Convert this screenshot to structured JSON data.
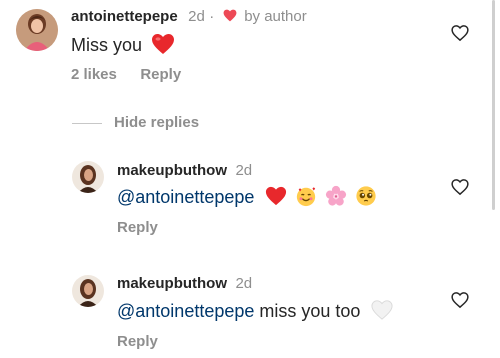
{
  "comment": {
    "username": "antoinettepepe",
    "time": "2d",
    "separator": "·",
    "by_author": "by author",
    "text": "Miss you",
    "text_emoji": "red-heart",
    "likes": "2 likes",
    "reply_label": "Reply"
  },
  "replies_toggle": {
    "label": "Hide replies"
  },
  "replies": [
    {
      "username": "makeupbuthow",
      "time": "2d",
      "mention": "@antoinettepepe",
      "text": "",
      "emojis": [
        "red-heart",
        "smiling-face-with-hearts",
        "cherry-blossom",
        "pleading-face"
      ],
      "reply_label": "Reply"
    },
    {
      "username": "makeupbuthow",
      "time": "2d",
      "mention": "@antoinettepepe",
      "text": "miss you too",
      "emojis": [
        "white-heart"
      ],
      "reply_label": "Reply"
    }
  ],
  "icons": {
    "like": "heart-outline-icon",
    "author_like": "red-heart-icon"
  },
  "colors": {
    "text": "#262626",
    "muted": "#8e8e8e",
    "mention": "#00376b",
    "heart": "#ed4956"
  }
}
